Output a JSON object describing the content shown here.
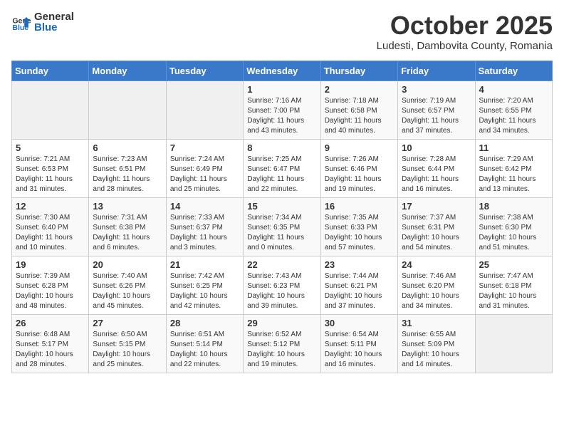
{
  "header": {
    "logo_general": "General",
    "logo_blue": "Blue",
    "month": "October 2025",
    "location": "Ludesti, Dambovita County, Romania"
  },
  "days_of_week": [
    "Sunday",
    "Monday",
    "Tuesday",
    "Wednesday",
    "Thursday",
    "Friday",
    "Saturday"
  ],
  "weeks": [
    [
      {
        "day": "",
        "info": ""
      },
      {
        "day": "",
        "info": ""
      },
      {
        "day": "",
        "info": ""
      },
      {
        "day": "1",
        "info": "Sunrise: 7:16 AM\nSunset: 7:00 PM\nDaylight: 11 hours\nand 43 minutes."
      },
      {
        "day": "2",
        "info": "Sunrise: 7:18 AM\nSunset: 6:58 PM\nDaylight: 11 hours\nand 40 minutes."
      },
      {
        "day": "3",
        "info": "Sunrise: 7:19 AM\nSunset: 6:57 PM\nDaylight: 11 hours\nand 37 minutes."
      },
      {
        "day": "4",
        "info": "Sunrise: 7:20 AM\nSunset: 6:55 PM\nDaylight: 11 hours\nand 34 minutes."
      }
    ],
    [
      {
        "day": "5",
        "info": "Sunrise: 7:21 AM\nSunset: 6:53 PM\nDaylight: 11 hours\nand 31 minutes."
      },
      {
        "day": "6",
        "info": "Sunrise: 7:23 AM\nSunset: 6:51 PM\nDaylight: 11 hours\nand 28 minutes."
      },
      {
        "day": "7",
        "info": "Sunrise: 7:24 AM\nSunset: 6:49 PM\nDaylight: 11 hours\nand 25 minutes."
      },
      {
        "day": "8",
        "info": "Sunrise: 7:25 AM\nSunset: 6:47 PM\nDaylight: 11 hours\nand 22 minutes."
      },
      {
        "day": "9",
        "info": "Sunrise: 7:26 AM\nSunset: 6:46 PM\nDaylight: 11 hours\nand 19 minutes."
      },
      {
        "day": "10",
        "info": "Sunrise: 7:28 AM\nSunset: 6:44 PM\nDaylight: 11 hours\nand 16 minutes."
      },
      {
        "day": "11",
        "info": "Sunrise: 7:29 AM\nSunset: 6:42 PM\nDaylight: 11 hours\nand 13 minutes."
      }
    ],
    [
      {
        "day": "12",
        "info": "Sunrise: 7:30 AM\nSunset: 6:40 PM\nDaylight: 11 hours\nand 10 minutes."
      },
      {
        "day": "13",
        "info": "Sunrise: 7:31 AM\nSunset: 6:38 PM\nDaylight: 11 hours\nand 6 minutes."
      },
      {
        "day": "14",
        "info": "Sunrise: 7:33 AM\nSunset: 6:37 PM\nDaylight: 11 hours\nand 3 minutes."
      },
      {
        "day": "15",
        "info": "Sunrise: 7:34 AM\nSunset: 6:35 PM\nDaylight: 11 hours\nand 0 minutes."
      },
      {
        "day": "16",
        "info": "Sunrise: 7:35 AM\nSunset: 6:33 PM\nDaylight: 10 hours\nand 57 minutes."
      },
      {
        "day": "17",
        "info": "Sunrise: 7:37 AM\nSunset: 6:31 PM\nDaylight: 10 hours\nand 54 minutes."
      },
      {
        "day": "18",
        "info": "Sunrise: 7:38 AM\nSunset: 6:30 PM\nDaylight: 10 hours\nand 51 minutes."
      }
    ],
    [
      {
        "day": "19",
        "info": "Sunrise: 7:39 AM\nSunset: 6:28 PM\nDaylight: 10 hours\nand 48 minutes."
      },
      {
        "day": "20",
        "info": "Sunrise: 7:40 AM\nSunset: 6:26 PM\nDaylight: 10 hours\nand 45 minutes."
      },
      {
        "day": "21",
        "info": "Sunrise: 7:42 AM\nSunset: 6:25 PM\nDaylight: 10 hours\nand 42 minutes."
      },
      {
        "day": "22",
        "info": "Sunrise: 7:43 AM\nSunset: 6:23 PM\nDaylight: 10 hours\nand 39 minutes."
      },
      {
        "day": "23",
        "info": "Sunrise: 7:44 AM\nSunset: 6:21 PM\nDaylight: 10 hours\nand 37 minutes."
      },
      {
        "day": "24",
        "info": "Sunrise: 7:46 AM\nSunset: 6:20 PM\nDaylight: 10 hours\nand 34 minutes."
      },
      {
        "day": "25",
        "info": "Sunrise: 7:47 AM\nSunset: 6:18 PM\nDaylight: 10 hours\nand 31 minutes."
      }
    ],
    [
      {
        "day": "26",
        "info": "Sunrise: 6:48 AM\nSunset: 5:17 PM\nDaylight: 10 hours\nand 28 minutes."
      },
      {
        "day": "27",
        "info": "Sunrise: 6:50 AM\nSunset: 5:15 PM\nDaylight: 10 hours\nand 25 minutes."
      },
      {
        "day": "28",
        "info": "Sunrise: 6:51 AM\nSunset: 5:14 PM\nDaylight: 10 hours\nand 22 minutes."
      },
      {
        "day": "29",
        "info": "Sunrise: 6:52 AM\nSunset: 5:12 PM\nDaylight: 10 hours\nand 19 minutes."
      },
      {
        "day": "30",
        "info": "Sunrise: 6:54 AM\nSunset: 5:11 PM\nDaylight: 10 hours\nand 16 minutes."
      },
      {
        "day": "31",
        "info": "Sunrise: 6:55 AM\nSunset: 5:09 PM\nDaylight: 10 hours\nand 14 minutes."
      },
      {
        "day": "",
        "info": ""
      }
    ]
  ]
}
